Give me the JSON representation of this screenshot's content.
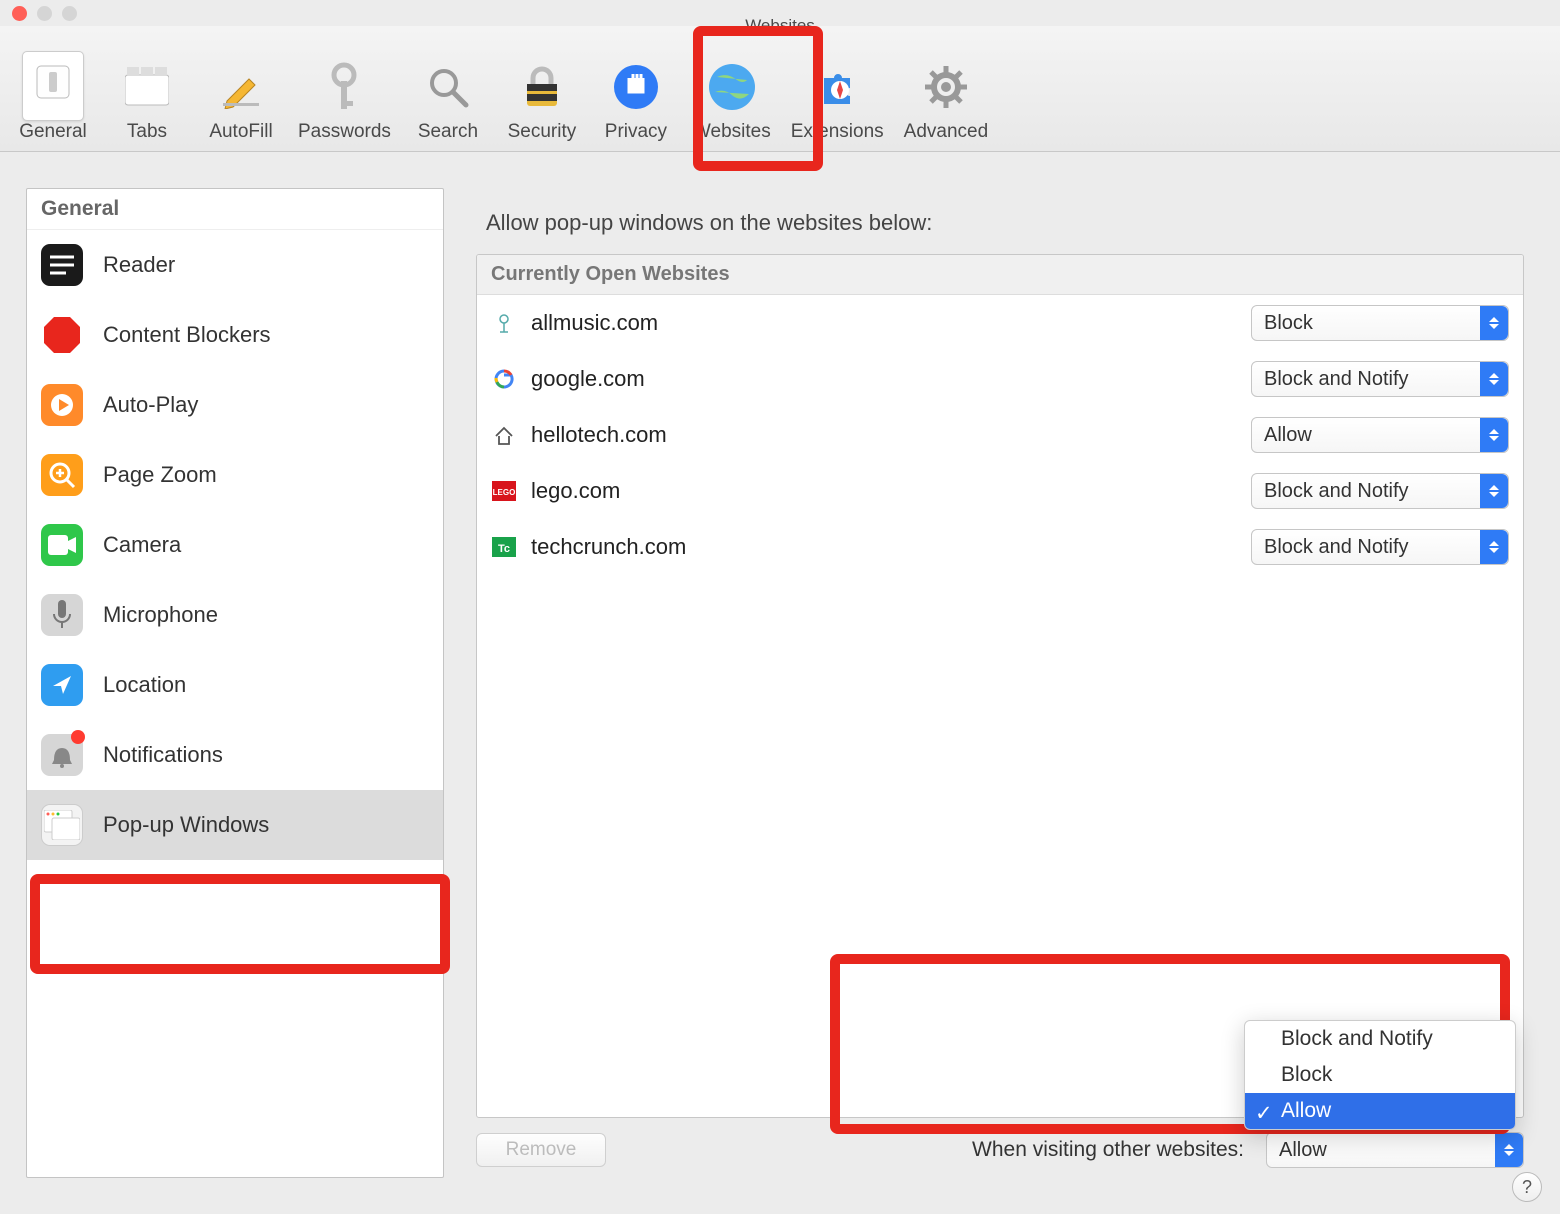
{
  "window": {
    "title": "Websites"
  },
  "toolbar": {
    "items": [
      {
        "label": "General"
      },
      {
        "label": "Tabs"
      },
      {
        "label": "AutoFill"
      },
      {
        "label": "Passwords"
      },
      {
        "label": "Search"
      },
      {
        "label": "Security"
      },
      {
        "label": "Privacy"
      },
      {
        "label": "Websites"
      },
      {
        "label": "Extensions"
      },
      {
        "label": "Advanced"
      }
    ]
  },
  "sidebar": {
    "header": "General",
    "items": [
      {
        "label": "Reader"
      },
      {
        "label": "Content Blockers"
      },
      {
        "label": "Auto-Play"
      },
      {
        "label": "Page Zoom"
      },
      {
        "label": "Camera"
      },
      {
        "label": "Microphone"
      },
      {
        "label": "Location"
      },
      {
        "label": "Notifications"
      },
      {
        "label": "Pop-up Windows"
      }
    ]
  },
  "main": {
    "title": "Allow pop-up windows on the websites below:",
    "table_header": "Currently Open Websites",
    "rows": [
      {
        "site": "allmusic.com",
        "value": "Block"
      },
      {
        "site": "google.com",
        "value": "Block and Notify"
      },
      {
        "site": "hellotech.com",
        "value": "Allow"
      },
      {
        "site": "lego.com",
        "value": "Block and Notify"
      },
      {
        "site": "techcrunch.com",
        "value": "Block and Notify"
      }
    ],
    "remove_label": "Remove",
    "footer_label": "When visiting other websites:",
    "dropdown_options": [
      "Block and Notify",
      "Block",
      "Allow"
    ],
    "dropdown_selected": "Allow"
  },
  "help": "?"
}
